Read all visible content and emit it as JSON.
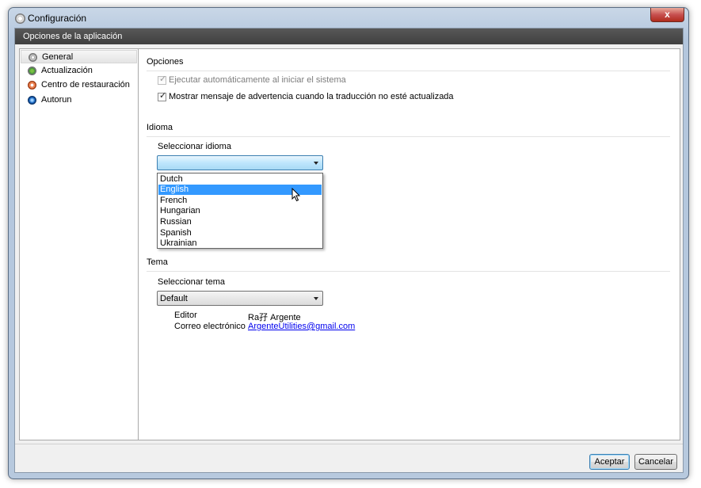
{
  "window": {
    "title": "Configuración",
    "close_glyph": "x",
    "title_icon": "gear-icon"
  },
  "header": {
    "title": "Opciones de la aplicación"
  },
  "sidebar": {
    "items": [
      {
        "label": "General",
        "icon": "gear-icon",
        "selected": true
      },
      {
        "label": "Actualización",
        "icon": "update-icon",
        "selected": false
      },
      {
        "label": "Centro de restauración",
        "icon": "lifebuoy-icon",
        "selected": false
      },
      {
        "label": "Autorun",
        "icon": "autorun-icon",
        "selected": false
      }
    ]
  },
  "options": {
    "section_title": "Opciones",
    "autostart": {
      "label": "Ejecutar automáticamente al iniciar el sistema",
      "checked": true,
      "disabled": true
    },
    "warning": {
      "label": "Mostrar mensaje de advertencia cuando la traducción no esté actualizada",
      "checked": true,
      "disabled": false
    }
  },
  "language": {
    "section_title": "Idioma",
    "select_label": "Seleccionar idioma",
    "selected_value": "",
    "options": [
      "Dutch",
      "English",
      "French",
      "Hungarian",
      "Russian",
      "Spanish",
      "Ukrainian"
    ],
    "hovered": "English"
  },
  "theme": {
    "section_title": "Tema",
    "select_label": "Seleccionar tema",
    "selected_value": "Default",
    "editor_label": "Editor",
    "editor_value": "Ra孖 Argente",
    "email_label": "Correo electrónico",
    "email_value": "ArgenteUtilities@gmail.com"
  },
  "footer": {
    "accept_label": "Aceptar",
    "cancel_label": "Cancelar"
  },
  "colors": {
    "header_bar": "#4a4a4a",
    "selection": "#3399ff",
    "link": "#0000ee"
  }
}
